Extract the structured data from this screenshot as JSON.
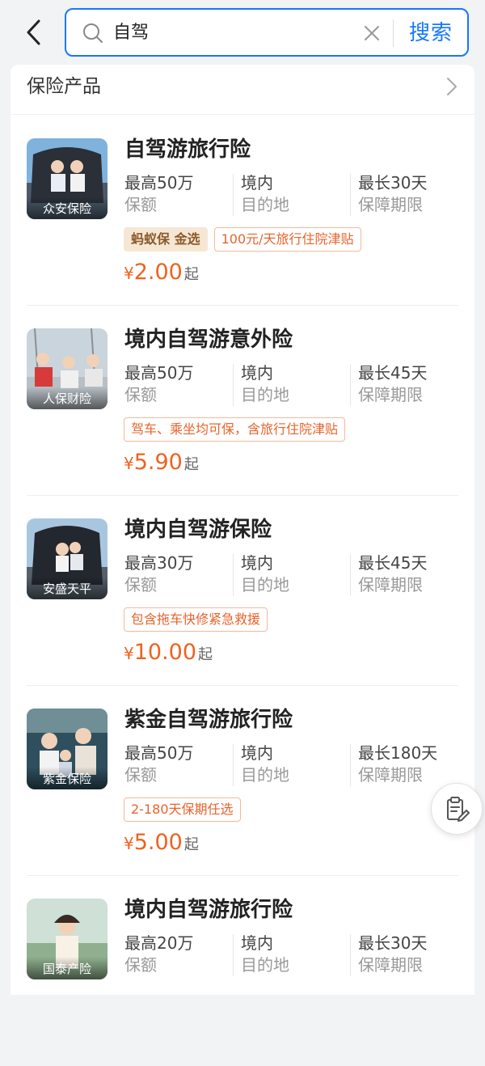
{
  "search": {
    "query": "自驾",
    "button": "搜索"
  },
  "section": {
    "title": "保险产品"
  },
  "products": [
    {
      "title": "自驾游旅行险",
      "provider": "众安保险",
      "coverage": "最高50万",
      "coverage_label": "保额",
      "destination": "境内",
      "destination_label": "目的地",
      "period": "最长30天",
      "period_label": "保障期限",
      "brand_tag": "蚂蚁保 金选",
      "tags": [
        "100元/天旅行住院津贴"
      ],
      "currency": "¥",
      "price": "2.00",
      "price_suffix": "起"
    },
    {
      "title": "境内自驾游意外险",
      "provider": "人保财险",
      "coverage": "最高50万",
      "coverage_label": "保额",
      "destination": "境内",
      "destination_label": "目的地",
      "period": "最长45天",
      "period_label": "保障期限",
      "tags": [
        "驾车、乘坐均可保，含旅行住院津贴"
      ],
      "currency": "¥",
      "price": "5.90",
      "price_suffix": "起"
    },
    {
      "title": "境内自驾游保险",
      "provider": "安盛天平",
      "coverage": "最高30万",
      "coverage_label": "保额",
      "destination": "境内",
      "destination_label": "目的地",
      "period": "最长45天",
      "period_label": "保障期限",
      "tags": [
        "包含拖车快修紧急救援"
      ],
      "currency": "¥",
      "price": "10.00",
      "price_suffix": "起"
    },
    {
      "title": "紫金自驾游旅行险",
      "provider": "紫金保险",
      "coverage": "最高50万",
      "coverage_label": "保额",
      "destination": "境内",
      "destination_label": "目的地",
      "period": "最长180天",
      "period_label": "保障期限",
      "tags": [
        "2-180天保期任选"
      ],
      "currency": "¥",
      "price": "5.00",
      "price_suffix": "起"
    },
    {
      "title": "境内自驾游旅行险",
      "provider": "国泰产险",
      "coverage": "最高20万",
      "coverage_label": "保额",
      "destination": "境内",
      "destination_label": "目的地",
      "period": "最长30天",
      "period_label": "保障期限"
    }
  ],
  "colors": {
    "accent": "#1677ff",
    "price": "#f0621f",
    "tag_border": "#f4b99a",
    "brand_tag_bg": "#f6e7d4"
  },
  "icons": [
    "back-arrow-icon",
    "search-icon",
    "clear-icon",
    "chevron-right-icon",
    "clipboard-edit-icon"
  ]
}
